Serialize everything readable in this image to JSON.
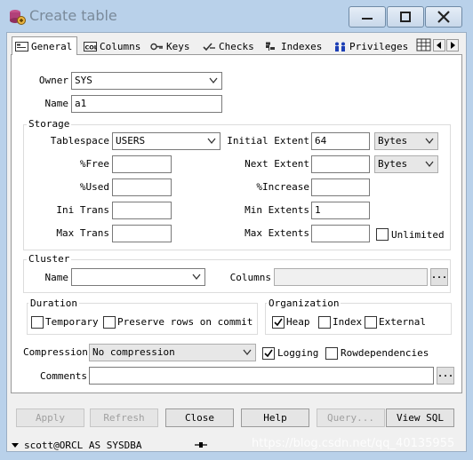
{
  "window": {
    "title": "Create table"
  },
  "tabs": [
    {
      "label": "General",
      "icon": "general-tab-icon"
    },
    {
      "label": "Columns",
      "icon": "columns-tab-icon"
    },
    {
      "label": "Keys",
      "icon": "keys-tab-icon"
    },
    {
      "label": "Checks",
      "icon": "checks-tab-icon"
    },
    {
      "label": "Indexes",
      "icon": "indexes-tab-icon"
    },
    {
      "label": "Privileges",
      "icon": "privileges-tab-icon"
    }
  ],
  "general": {
    "owner_label": "Owner",
    "owner_value": "SYS",
    "name_label": "Name",
    "name_value": "a1"
  },
  "storage": {
    "title": "Storage",
    "tablespace_label": "Tablespace",
    "tablespace_value": "USERS",
    "free_label": "%Free",
    "free_value": "",
    "used_label": "%Used",
    "used_value": "",
    "ini_trans_label": "Ini Trans",
    "ini_trans_value": "",
    "max_trans_label": "Max Trans",
    "max_trans_value": "",
    "initial_extent_label": "Initial Extent",
    "initial_extent_value": "64",
    "initial_extent_unit": "Bytes",
    "next_extent_label": "Next Extent",
    "next_extent_value": "",
    "next_extent_unit": "Bytes",
    "increase_label": "%Increase",
    "increase_value": "",
    "min_extents_label": "Min Extents",
    "min_extents_value": "1",
    "max_extents_label": "Max Extents",
    "max_extents_value": "",
    "unlimited_label": "Unlimited",
    "unlimited_checked": false
  },
  "cluster": {
    "title": "Cluster",
    "name_label": "Name",
    "name_value": "",
    "columns_label": "Columns",
    "columns_value": ""
  },
  "duration": {
    "title": "Duration",
    "temporary_label": "Temporary",
    "temporary_checked": false,
    "preserve_label": "Preserve rows on commit",
    "preserve_checked": false
  },
  "organization": {
    "title": "Organization",
    "heap_label": "Heap",
    "heap_checked": true,
    "index_label": "Index",
    "index_checked": false,
    "external_label": "External",
    "external_checked": false
  },
  "compression": {
    "label": "Compression",
    "value": "No compression",
    "logging_label": "Logging",
    "logging_checked": true,
    "rowdependencies_label": "Rowdependencies",
    "rowdependencies_checked": false
  },
  "comments": {
    "label": "Comments",
    "value": ""
  },
  "buttons": {
    "apply": "Apply",
    "refresh": "Refresh",
    "close": "Close",
    "help": "Help",
    "query": "Query...",
    "view_sql": "View SQL"
  },
  "status": {
    "connection": "scott@ORCL AS SYSDBA",
    "watermark": "https://blog.csdn.net/qq_40135955"
  },
  "colors": {
    "title_bar": "#b9d1ea",
    "client_bg": "#f0f0f0",
    "close_hover": "#c94c4c"
  }
}
